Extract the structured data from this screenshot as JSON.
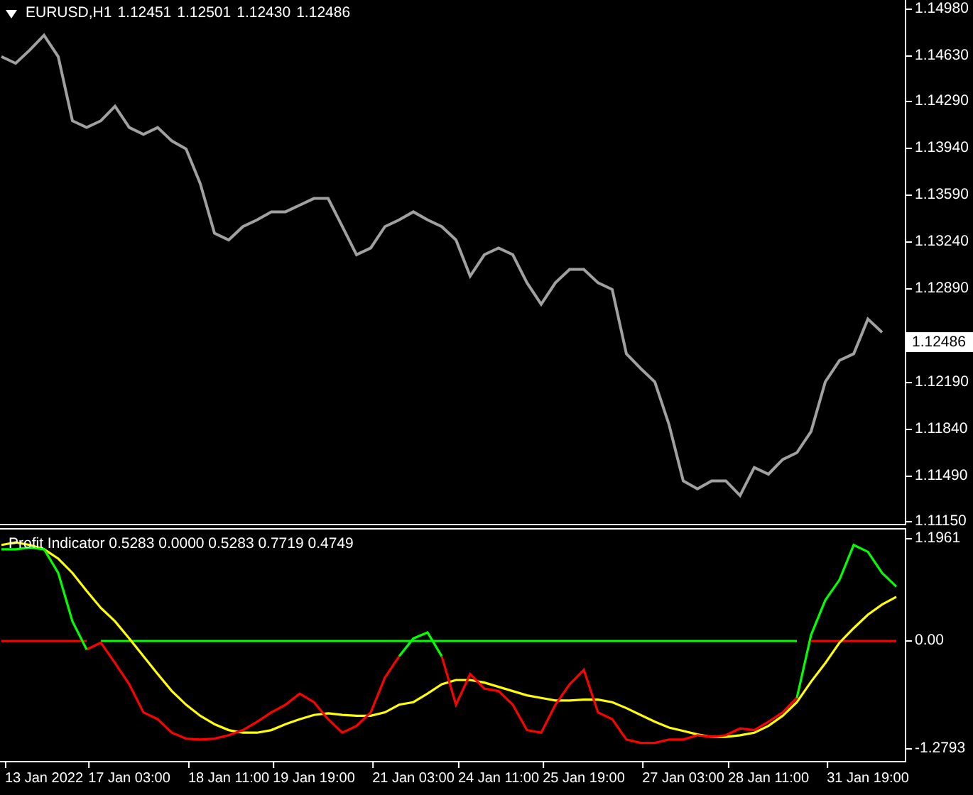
{
  "main_chart": {
    "symbol": "EURUSD,H1",
    "ohlc": [
      "1.12451",
      "1.12501",
      "1.12430",
      "1.12486"
    ],
    "price_marker": {
      "label": "1.12486"
    },
    "chart_data": {
      "type": "line",
      "ylim": [
        1.11129,
        1.15043
      ],
      "yticks": [
        {
          "value": 1.1498,
          "label": "1.14980"
        },
        {
          "value": 1.1463,
          "label": "1.14630"
        },
        {
          "value": 1.1429,
          "label": "1.14290"
        },
        {
          "value": 1.1394,
          "label": "1.13940"
        },
        {
          "value": 1.1359,
          "label": "1.13590"
        },
        {
          "value": 1.1324,
          "label": "1.13240"
        },
        {
          "value": 1.1289,
          "label": "1.12890"
        },
        {
          "value": 1.1219,
          "label": "1.12190"
        },
        {
          "value": 1.1184,
          "label": "1.11840"
        },
        {
          "value": 1.1149,
          "label": "1.11490"
        },
        {
          "value": 1.1115,
          "label": "1.11150"
        }
      ],
      "categories": [
        null,
        null,
        null,
        null,
        null,
        null,
        null,
        null,
        null,
        null,
        null,
        null,
        null,
        null,
        null,
        null,
        null,
        null,
        null,
        null,
        null,
        null,
        null,
        null,
        null,
        null,
        null,
        null,
        null,
        null,
        null,
        null,
        null,
        null,
        null,
        null,
        null,
        null,
        null,
        null,
        null,
        null,
        null,
        null,
        null,
        null,
        null,
        null,
        null,
        null,
        null,
        null,
        null,
        null,
        null,
        null,
        null,
        null,
        null,
        null,
        null,
        null,
        null
      ],
      "series": [
        {
          "color": "#a0a0a0",
          "values": [
            1.1462,
            1.1457,
            1.1467,
            1.1478,
            1.1462,
            1.1414,
            1.1409,
            1.1414,
            1.1425,
            1.1409,
            1.1404,
            1.1409,
            1.1399,
            1.1393,
            1.1367,
            1.133,
            1.1325,
            1.1335,
            1.134,
            1.1346,
            1.1346,
            1.1351,
            1.1356,
            1.1356,
            1.1335,
            1.1314,
            1.1319,
            1.1335,
            1.134,
            1.1346,
            1.134,
            1.1335,
            1.1325,
            1.1298,
            1.1314,
            1.1319,
            1.1314,
            1.1293,
            1.1277,
            1.1293,
            1.1303,
            1.1303,
            1.1293,
            1.1288,
            1.124,
            1.1229,
            1.1219,
            1.1187,
            1.1145,
            1.1139,
            1.1145,
            1.1145,
            1.1134,
            1.1155,
            1.115,
            1.1161,
            1.1166,
            1.1182,
            1.1219,
            1.1235,
            1.124,
            1.1266,
            1.1256
          ]
        }
      ]
    }
  },
  "indicator": {
    "title": "Profit Indicator 0.5283 0.0000 0.5283 0.7719 0.4749",
    "chart_data": {
      "type": "line",
      "ylim": [
        -1.412,
        1.312
      ],
      "yticks": [
        {
          "value": 1.1961,
          "label": "1.1961"
        },
        {
          "value": 0,
          "label": "0.00"
        },
        {
          "value": -1.2793,
          "label": "-1.2793"
        }
      ],
      "categories": [
        null,
        null,
        null,
        "13 Jan 2022",
        null,
        null,
        null,
        null,
        null,
        "17 Jan 03:00",
        null,
        null,
        null,
        null,
        null,
        null,
        "18 Jan 11:00",
        null,
        null,
        null,
        null,
        null,
        "19 Jan 19:00",
        null,
        null,
        null,
        null,
        null,
        null,
        "21 Jan 03:00",
        null,
        null,
        null,
        null,
        null,
        "24 Jan 11:00",
        null,
        null,
        null,
        null,
        null,
        "25 Jan 19:00",
        null,
        null,
        null,
        null,
        null,
        null,
        "27 Jan 03:00",
        null,
        null,
        null,
        null,
        null,
        "28 Jan 11:00",
        null,
        null,
        null,
        null,
        null,
        null,
        "31 Jan 19:00",
        null,
        null
      ],
      "series": [
        {
          "color": "#ff0000",
          "values": [
            0,
            0,
            0,
            0,
            0,
            0,
            0,
            null,
            null,
            null,
            null,
            null,
            null,
            null,
            null,
            null,
            null,
            null,
            null,
            null,
            null,
            null,
            null,
            null,
            null,
            null,
            null,
            null,
            null,
            null,
            null,
            null,
            null,
            null,
            null,
            null,
            null,
            null,
            null,
            null,
            null,
            null,
            null,
            null,
            null,
            null,
            null,
            null,
            null,
            null,
            null,
            null,
            null,
            null,
            null,
            null,
            null,
            0,
            0,
            0,
            0,
            0,
            0,
            0
          ]
        },
        {
          "color": "#00ff00",
          "values": [
            null,
            null,
            null,
            null,
            null,
            null,
            null,
            0,
            0,
            0,
            0,
            0,
            0,
            0,
            0,
            0,
            0,
            0,
            0,
            0,
            0,
            0,
            0,
            0,
            0,
            0,
            0,
            0,
            0,
            0,
            0,
            0,
            0,
            0,
            0,
            0,
            0,
            0,
            0,
            0,
            0,
            0,
            0,
            0,
            0,
            0,
            0,
            0,
            0,
            0,
            0,
            0,
            0,
            0,
            0,
            0,
            0,
            null,
            null,
            null,
            null,
            null,
            null,
            null
          ]
        },
        {
          "color": "#ffff00",
          "values": [
            1.13,
            1.16,
            1.13,
            1.08,
            0.97,
            0.8,
            0.59,
            0.39,
            0.23,
            0.03,
            -0.18,
            -0.39,
            -0.59,
            -0.75,
            -0.88,
            -0.98,
            -1.05,
            -1.08,
            -1.08,
            -1.05,
            -0.98,
            -0.92,
            -0.87,
            -0.85,
            -0.87,
            -0.88,
            -0.88,
            -0.84,
            -0.75,
            -0.72,
            -0.62,
            -0.51,
            -0.46,
            -0.46,
            -0.49,
            -0.54,
            -0.59,
            -0.64,
            -0.67,
            -0.7,
            -0.7,
            -0.69,
            -0.69,
            -0.72,
            -0.79,
            -0.87,
            -0.95,
            -1.02,
            -1.06,
            -1.1,
            -1.13,
            -1.13,
            -1.11,
            -1.08,
            -1.0,
            -0.88,
            -0.72,
            -0.48,
            -0.26,
            -0.02,
            0.15,
            0.31,
            0.43,
            0.52
          ]
        },
        {
          "color": "#ff0000",
          "values": [
            null,
            null,
            null,
            null,
            null,
            null,
            -0.1,
            -0.02,
            -0.26,
            -0.51,
            -0.84,
            -0.92,
            -1.08,
            -1.15,
            -1.16,
            -1.15,
            -1.11,
            -1.05,
            -0.95,
            -0.84,
            -0.75,
            -0.62,
            -0.72,
            -0.92,
            -1.08,
            -1.0,
            -0.84,
            -0.43,
            -0.18,
            null,
            null,
            -0.18,
            -0.75,
            -0.39,
            -0.56,
            -0.59,
            -0.75,
            -1.05,
            -1.08,
            -0.75,
            -0.51,
            -0.34,
            -0.84,
            -0.92,
            -1.16,
            -1.2,
            -1.2,
            -1.16,
            -1.16,
            -1.11,
            -1.13,
            -1.11,
            -1.03,
            -1.05,
            -0.95,
            -0.84,
            -0.67,
            null,
            null,
            null,
            null,
            null,
            null,
            null
          ]
        },
        {
          "color": "#00ff00",
          "values": [
            1.08,
            1.08,
            1.1,
            1.08,
            0.8,
            0.23,
            -0.1,
            null,
            null,
            null,
            null,
            null,
            null,
            null,
            null,
            null,
            null,
            null,
            null,
            null,
            null,
            null,
            null,
            null,
            null,
            null,
            null,
            null,
            -0.18,
            0.03,
            0.1,
            -0.18,
            null,
            null,
            null,
            null,
            null,
            null,
            null,
            null,
            null,
            null,
            null,
            null,
            null,
            null,
            null,
            null,
            null,
            null,
            null,
            null,
            null,
            null,
            null,
            null,
            -0.67,
            0.07,
            0.48,
            0.72,
            1.13,
            1.05,
            0.8,
            0.64
          ]
        }
      ]
    }
  }
}
